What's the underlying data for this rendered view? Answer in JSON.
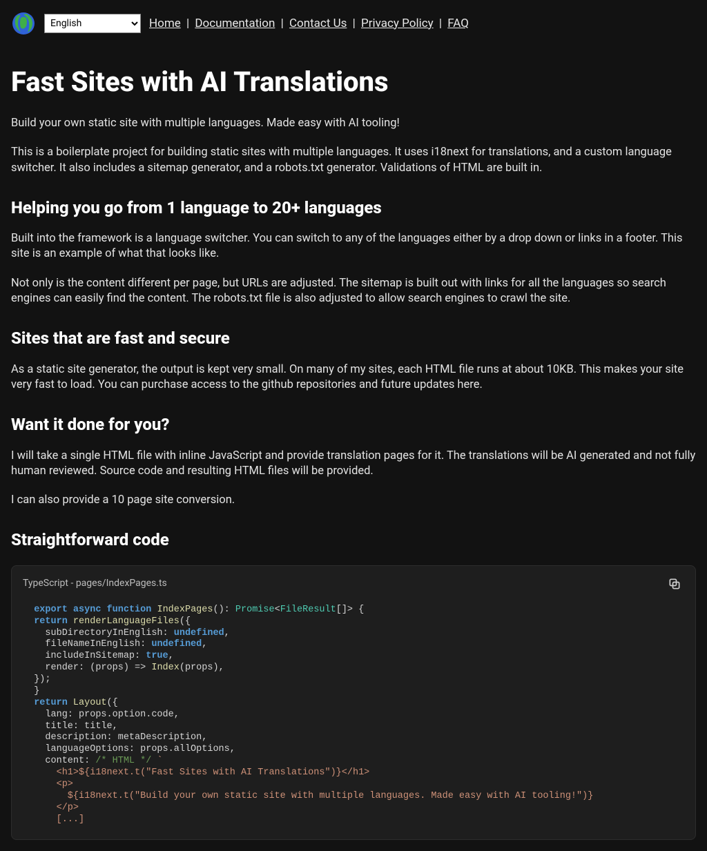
{
  "header": {
    "language_select": {
      "selected": "English"
    },
    "nav": {
      "home": "Home",
      "documentation": "Documentation",
      "contact": "Contact Us",
      "privacy": "Privacy Policy",
      "faq": "FAQ",
      "sep": " | "
    }
  },
  "main": {
    "h1": "Fast Sites with AI Translations",
    "intro1": "Build your own static site with multiple languages. Made easy with AI tooling!",
    "intro2": "This is a boilerplate project for building static sites with multiple languages. It uses i18next for translations, and a custom language switcher. It also includes a sitemap generator, and a robots.txt generator. Validations of HTML are built in.",
    "h2a": "Helping you go from 1 language to 20+ languages",
    "p_a1": "Built into the framework is a language switcher. You can switch to any of the languages either by a drop down or links in a footer. This site is an example of what that looks like.",
    "p_a2": "Not only is the content different per page, but URLs are adjusted. The sitemap is built out with links for all the languages so search engines can easily find the content. The robots.txt file is also adjusted to allow search engines to crawl the site.",
    "h2b": "Sites that are fast and secure",
    "p_b1": "As a static site generator, the output is kept very small. On many of my sites, each HTML file runs at about 10KB. This makes your site very fast to load. You can purchase access to the github repositories and future updates here.",
    "h2c": "Want it done for you?",
    "p_c1": "I will take a single HTML file with inline JavaScript and provide translation pages for it. The translations will be AI generated and not fully human reviewed. Source code and resulting HTML files will be provided.",
    "p_c2": "I can also provide a 10 page site conversion.",
    "h2d": "Straightforward code"
  },
  "code": {
    "label": "TypeScript - pages/IndexPages.ts",
    "t": {
      "export": "export",
      "async": "async",
      "function": "function",
      "IndexPages": "IndexPages",
      "sig1": "(): ",
      "Promise": "Promise",
      "lt": "<",
      "FileResult": "FileResult",
      "sig2": "[]> {",
      "return": "return",
      "renderLanguageFiles": "renderLanguageFiles",
      "openObj": "({",
      "line_sub": "    subDirectoryInEnglish: ",
      "undefined": "undefined",
      "comma": ",",
      "line_file": "    fileNameInEnglish: ",
      "line_inc": "    includeInSitemap: ",
      "true": "true",
      "line_render_pre": "    render: (props) => ",
      "Index": "Index",
      "line_render_post": "(props),",
      "closeObj": "  });",
      "closeBrace": "}",
      "Layout": "Layout",
      "line_lang": "    lang: props.option.code,",
      "line_title": "    title: title,",
      "line_desc": "    description: metaDescription,",
      "line_opts": "    languageOptions: props.allOptions,",
      "line_content_pre": "    content: ",
      "html_cmt": "/* HTML */ ",
      "backtick": "`",
      "tpl1": "      <h1>${i18next.t(\"Fast Sites with AI Translations\")}</h1>",
      "tpl2": "      <p>",
      "tpl3": "        ${i18next.t(\"Build your own static site with multiple languages. Made easy with AI tooling!\")}",
      "tpl4": "      </p>",
      "tpl5": "      [...]"
    }
  }
}
